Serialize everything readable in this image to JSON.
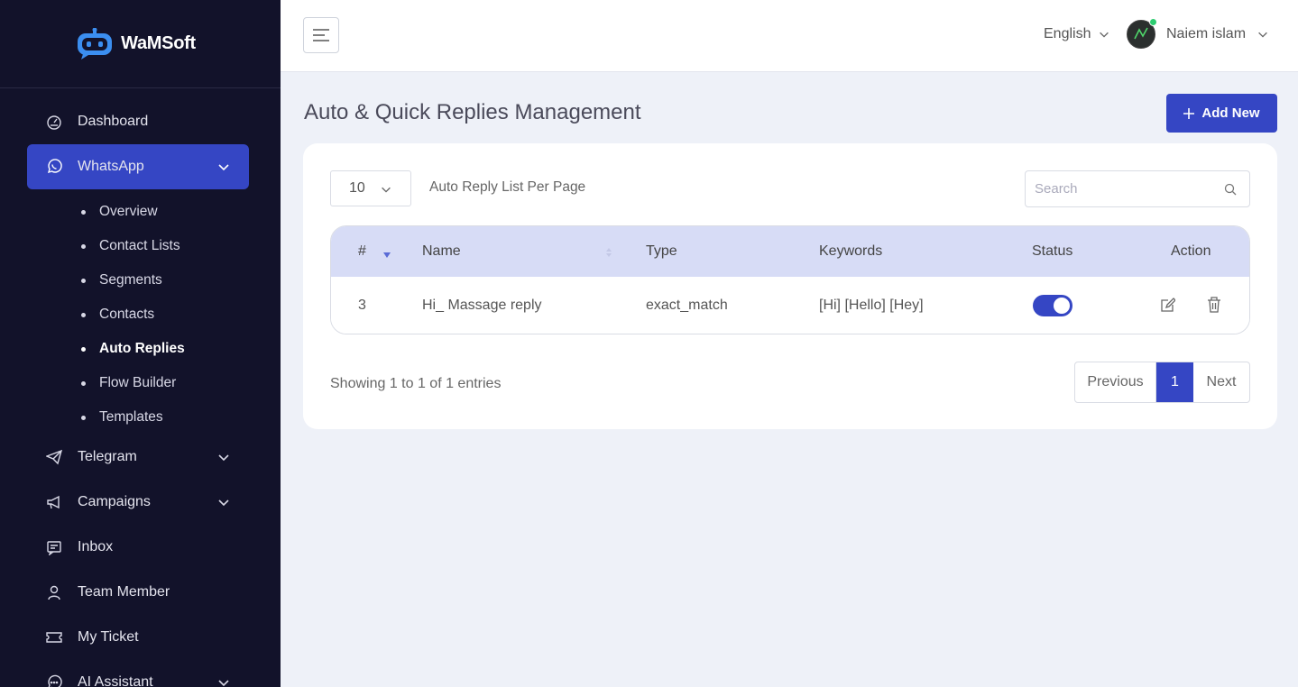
{
  "brand": {
    "name": "WaMSoft"
  },
  "sidebar": {
    "items": [
      {
        "label": "Dashboard",
        "icon": "dashboard-icon"
      },
      {
        "label": "WhatsApp",
        "icon": "whatsapp-icon",
        "active": true
      },
      {
        "label": "Telegram",
        "icon": "telegram-icon"
      },
      {
        "label": "Campaigns",
        "icon": "megaphone-icon"
      },
      {
        "label": "Inbox",
        "icon": "inbox-icon"
      },
      {
        "label": "Team Member",
        "icon": "user-icon"
      },
      {
        "label": "My Ticket",
        "icon": "ticket-icon"
      },
      {
        "label": "AI Assistant",
        "icon": "chat-icon"
      }
    ],
    "whatsapp_sub": [
      "Overview",
      "Contact Lists",
      "Segments",
      "Contacts",
      "Auto Replies",
      "Flow Builder",
      "Templates"
    ]
  },
  "topbar": {
    "language": "English",
    "user_name": "Naiem islam"
  },
  "page": {
    "title": "Auto & Quick Replies Management",
    "add_button": "Add New"
  },
  "table_controls": {
    "per_page_value": "10",
    "per_page_label": "Auto Reply List Per Page",
    "search_placeholder": "Search"
  },
  "table": {
    "headers": [
      "#",
      "Name",
      "Type",
      "Keywords",
      "Status",
      "Action"
    ],
    "rows": [
      {
        "id": "3",
        "name": "Hi_ Massage reply",
        "type": "exact_match",
        "keywords": "[Hi] [Hello] [Hey]",
        "status": true
      }
    ]
  },
  "footer": {
    "showing": "Showing 1 to 1 of 1 entries",
    "prev": "Previous",
    "page": "1",
    "next": "Next"
  },
  "colors": {
    "accent": "#3546c4",
    "sidebar_bg": "#12122a",
    "header_row": "#d7dcf6"
  }
}
